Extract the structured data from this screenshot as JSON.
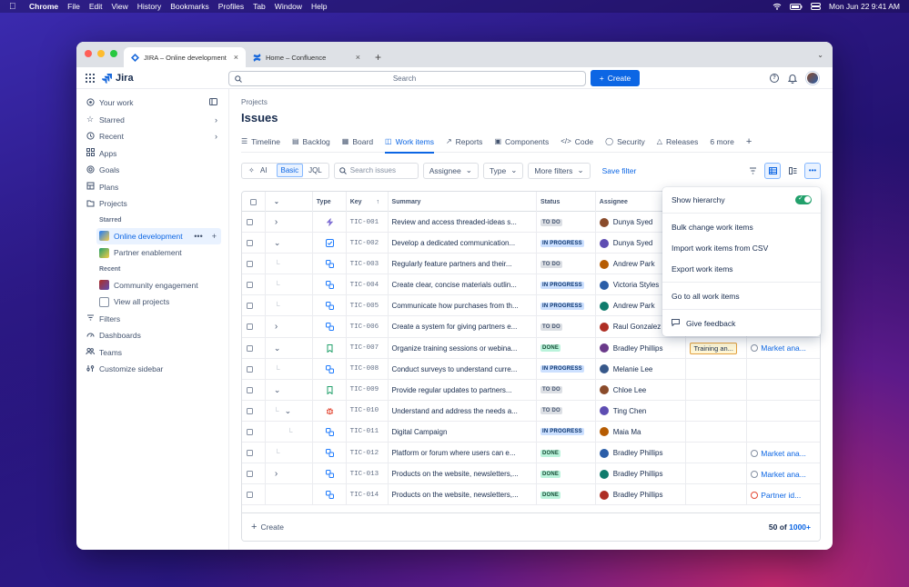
{
  "menubar": {
    "app": "Chrome",
    "items": [
      "File",
      "Edit",
      "View",
      "History",
      "Bookmarks",
      "Profiles",
      "Tab",
      "Window",
      "Help"
    ],
    "datetime": "Mon Jun 22  9:41 AM"
  },
  "browser": {
    "tabs": [
      {
        "title": "JIRA – Online development"
      },
      {
        "title": "Home – Confluence"
      }
    ]
  },
  "topnav": {
    "product": "Jira",
    "search_placeholder": "Search",
    "create_label": "Create"
  },
  "sidebar": {
    "items": [
      {
        "label": "Your work",
        "icon": "your-work"
      },
      {
        "label": "Starred",
        "icon": "star"
      },
      {
        "label": "Recent",
        "icon": "clock"
      },
      {
        "label": "Apps",
        "icon": "apps"
      },
      {
        "label": "Goals",
        "icon": "goal"
      },
      {
        "label": "Plans",
        "icon": "plans"
      },
      {
        "label": "Projects",
        "icon": "projects"
      }
    ],
    "starred_heading": "Starred",
    "starred": [
      {
        "label": "Online development",
        "color": "#1d7afc"
      },
      {
        "label": "Partner enablement",
        "color": "#22a06b"
      }
    ],
    "recent_heading": "Recent",
    "recent": [
      {
        "label": "Community engagement",
        "color": "#ae2e24"
      }
    ],
    "view_all": "View all projects",
    "bottom": [
      {
        "label": "Filters"
      },
      {
        "label": "Dashboards"
      },
      {
        "label": "Teams"
      },
      {
        "label": "Customize sidebar"
      }
    ]
  },
  "main": {
    "breadcrumb": "Projects",
    "title": "Issues",
    "tabs": [
      "Timeline",
      "Backlog",
      "Board",
      "Work items",
      "Reports",
      "Components",
      "Code",
      "Security",
      "Releases",
      "6 more"
    ],
    "active_tab": "Work items",
    "toolbar": {
      "ai": "AI",
      "basic": "Basic",
      "jql": "JQL",
      "search_placeholder": "Search issues",
      "assignee": "Assignee",
      "type": "Type",
      "more_filters": "More filters",
      "save_filter": "Save filter"
    }
  },
  "table": {
    "columns": [
      "Type",
      "Key",
      "Summary",
      "Status",
      "Assignee"
    ],
    "rows": [
      {
        "key": "TIC-001",
        "summary": "Review and access threaded-ideas s...",
        "status": "TO DO",
        "assignee": "Dunya Syed",
        "type": "epic",
        "expand": "right",
        "child": false,
        "extra1": "",
        "extra2": ""
      },
      {
        "key": "TIC-002",
        "summary": "Develop a dedicated communication...",
        "status": "IN PROGRESS",
        "assignee": "Dunya Syed",
        "type": "task",
        "expand": "down",
        "child": false,
        "extra1": "",
        "extra2": ""
      },
      {
        "key": "TIC-003",
        "summary": "Regularly feature partners and their...",
        "status": "TO DO",
        "assignee": "Andrew Park",
        "type": "subtask",
        "expand": "",
        "child": true,
        "extra1": "",
        "extra2": ""
      },
      {
        "key": "TIC-004",
        "summary": "Create clear, concise materials outlin...",
        "status": "IN PROGRESS",
        "assignee": "Victoria Styles",
        "type": "subtask",
        "expand": "",
        "child": true,
        "extra1": "",
        "extra2": ""
      },
      {
        "key": "TIC-005",
        "summary": "Communicate how purchases from th...",
        "status": "IN PROGRESS",
        "assignee": "Andrew Park",
        "type": "subtask",
        "expand": "",
        "child": true,
        "extra1": "",
        "extra2": ""
      },
      {
        "key": "TIC-006",
        "summary": "Create a system for giving partners e...",
        "status": "TO DO",
        "assignee": "Raul Gonzalez",
        "type": "subtask",
        "expand": "right",
        "child": false,
        "extra1": "",
        "extra2": ""
      },
      {
        "key": "TIC-007",
        "summary": "Organize training sessions or webina...",
        "status": "DONE",
        "assignee": "Bradley Phillips",
        "type": "story",
        "expand": "down",
        "child": false,
        "extra1": "Training an...",
        "extra2": "Market ana..."
      },
      {
        "key": "TIC-008",
        "summary": "Conduct surveys to understand curre...",
        "status": "IN PROGRESS",
        "assignee": "Melanie Lee",
        "type": "subtask",
        "expand": "",
        "child": true,
        "extra1": "",
        "extra2": ""
      },
      {
        "key": "TIC-009",
        "summary": "Provide regular updates to partners...",
        "status": "TO DO",
        "assignee": "Chloe Lee",
        "type": "story",
        "expand": "down",
        "child": false,
        "extra1": "",
        "extra2": ""
      },
      {
        "key": "TIC-010",
        "summary": "Understand and address the needs a...",
        "status": "TO DO",
        "assignee": "Ting Chen",
        "type": "bug",
        "expand": "down2",
        "child": true,
        "extra1": "",
        "extra2": ""
      },
      {
        "key": "TIC-011",
        "summary": "Digital Campaign",
        "status": "IN PROGRESS",
        "assignee": "Maia Ma",
        "type": "subtask",
        "expand": "",
        "child": true,
        "extra1": "",
        "extra2": ""
      },
      {
        "key": "TIC-012",
        "summary": "Platform or forum where users can e...",
        "status": "DONE",
        "assignee": "Bradley Phillips",
        "type": "subtask",
        "expand": "",
        "child": true,
        "extra1": "",
        "extra2": "Market ana..."
      },
      {
        "key": "TIC-013",
        "summary": "Products on the website, newsletters,...",
        "status": "DONE",
        "assignee": "Bradley Phillips",
        "type": "subtask",
        "expand": "right",
        "child": false,
        "extra1": "",
        "extra2": "Market ana..."
      },
      {
        "key": "TIC-014",
        "summary": "Products on the website, newsletters,...",
        "status": "DONE",
        "assignee": "Bradley Phillips",
        "type": "subtask",
        "expand": "",
        "child": false,
        "extra1": "",
        "extra2": "Partner id..."
      }
    ],
    "footer_create": "Create",
    "count_prefix": "50 of",
    "count_total": "1000+"
  },
  "menu": {
    "items": [
      "Show hierarchy",
      "Bulk change work items",
      "Import work items from CSV",
      "Export work items",
      "Go to all work items",
      "Give feedback"
    ],
    "show_hierarchy_on": true
  },
  "colors": {
    "accent": "#0c66e4",
    "done": "#baf3db",
    "in_progress": "#cce0ff",
    "todo": "#dcdfe4"
  }
}
